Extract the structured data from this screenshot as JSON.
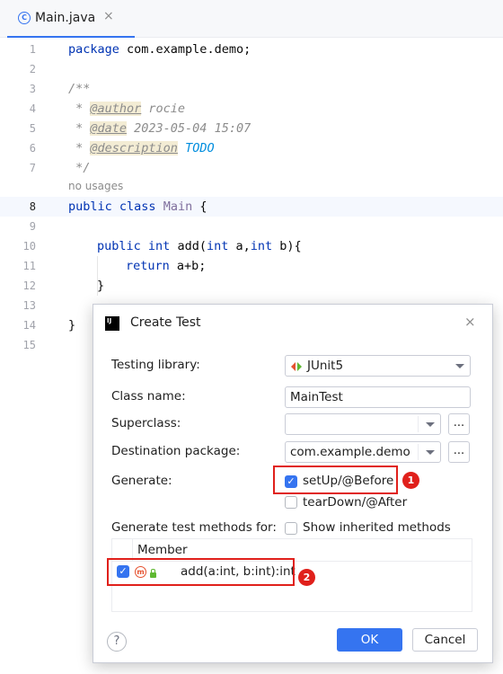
{
  "tab": {
    "icon_letter": "C",
    "label": "Main.java",
    "close": "×"
  },
  "editor": {
    "line_numbers": [
      "1",
      "2",
      "3",
      "4",
      "5",
      "6",
      "7",
      "8",
      "9",
      "10",
      "11",
      "12",
      "13",
      "14",
      "15"
    ],
    "code": {
      "l1_kw": "package",
      "l1_rest": " com.example.demo;",
      "l3": "/**",
      "l4_pre": " * ",
      "l4_tag": "@author",
      "l4_val": " rocie",
      "l5_pre": " * ",
      "l5_tag": "@date",
      "l5_val": " 2023-05-04 15:07",
      "l6_pre": " * ",
      "l6_tag": "@description",
      "l6_val": "TODO",
      "l7": " */",
      "usage_hint": "no usages",
      "l8_kw1": "public",
      "l8_kw2": "class",
      "l8_name": "Main",
      "l8_rest": " {",
      "l10_kw1": "public",
      "l10_kw2": "int",
      "l10_name": "add(",
      "l10_kw3": "int",
      "l10_mid": " a,",
      "l10_kw4": "int",
      "l10_end": " b){",
      "l11_kw": "return",
      "l11_rest": " a+b;",
      "l12": "}",
      "l14": "}"
    }
  },
  "dialog": {
    "title": "Create Test",
    "logo_text": "IJ",
    "close": "×",
    "testing_library": {
      "label": "Testing library:",
      "value": "JUnit5"
    },
    "class_name": {
      "label": "Class name:",
      "value": "MainTest"
    },
    "superclass": {
      "label": "Superclass:",
      "value": "",
      "more": "..."
    },
    "destination_package": {
      "label": "Destination package:",
      "value": "com.example.demo",
      "more": "..."
    },
    "generate": {
      "label": "Generate:",
      "setup": {
        "label": "setUp/@Before",
        "checked": true
      },
      "teardown": {
        "label": "tearDown/@After",
        "checked": false
      }
    },
    "methods": {
      "label": "Generate test methods for:",
      "show_inherited": {
        "label": "Show inherited methods",
        "checked": false
      }
    },
    "table": {
      "header": "Member",
      "rows": [
        {
          "checked": true,
          "icon_letter": "m",
          "signature": "add(a:int, b:int):int"
        }
      ]
    },
    "badges": [
      "1",
      "2"
    ],
    "help": "?",
    "ok": "OK",
    "cancel": "Cancel",
    "check_mark": "✓"
  },
  "colors": {
    "accent": "#3574f0",
    "annotation_red": "#e0201b",
    "keyword": "#0033b3"
  }
}
